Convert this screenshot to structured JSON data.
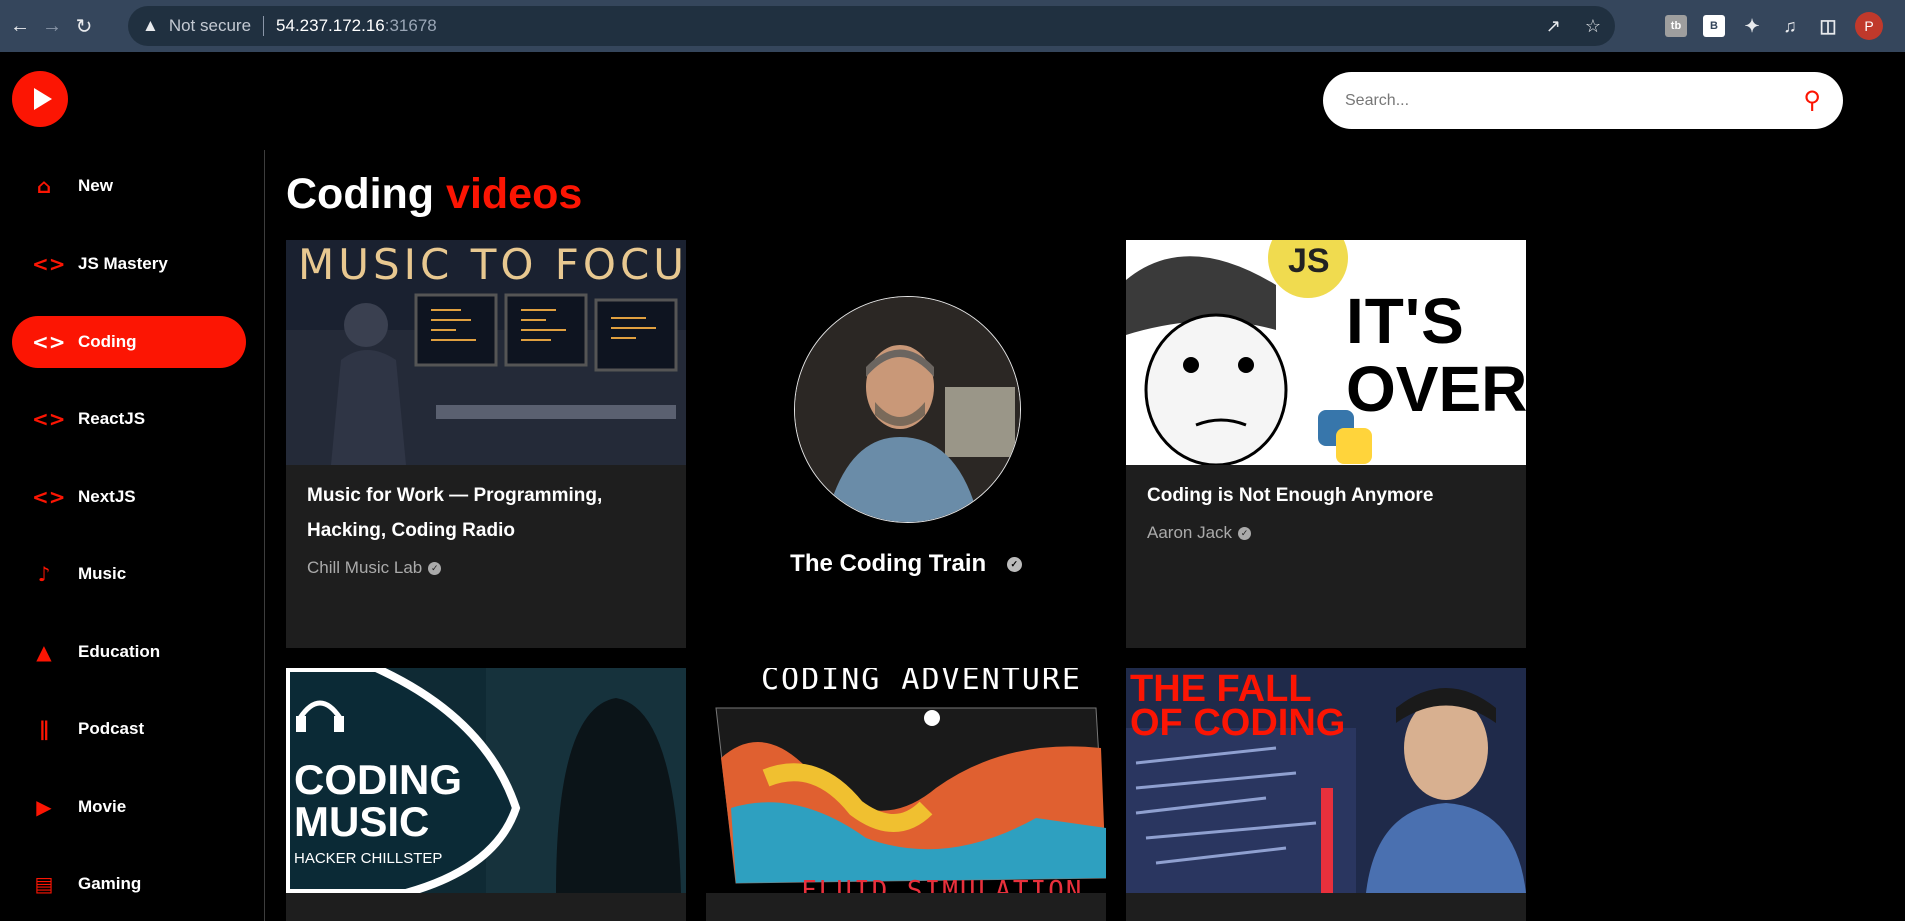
{
  "browser": {
    "warning_text": "Not secure",
    "url_host": "54.237.172.16",
    "url_port": ":31678",
    "ext_badges": [
      "tb",
      "B"
    ],
    "profile_initial": "P"
  },
  "search": {
    "placeholder": "Search..."
  },
  "title": {
    "main": "Coding",
    "accent": "videos"
  },
  "sidebar": {
    "items": [
      {
        "label": "New",
        "icon": "home-icon"
      },
      {
        "label": "JS Mastery",
        "icon": "code-icon"
      },
      {
        "label": "Coding",
        "icon": "code-icon",
        "active": true
      },
      {
        "label": "ReactJS",
        "icon": "code-icon"
      },
      {
        "label": "NextJS",
        "icon": "code-icon"
      },
      {
        "label": "Music",
        "icon": "music-note-icon"
      },
      {
        "label": "Education",
        "icon": "school-icon"
      },
      {
        "label": "Podcast",
        "icon": "podcast-icon"
      },
      {
        "label": "Movie",
        "icon": "live-tv-icon"
      },
      {
        "label": "Gaming",
        "icon": "gamepad-icon"
      }
    ]
  },
  "videos": [
    {
      "title": "Music for Work — Programming, Hacking, Coding Radio",
      "channel": "Chill Music Lab",
      "thumb_text": "MUSIC TO FOCU"
    },
    {
      "title": "Coding is Not Enough Anymore",
      "channel": "Aaron Jack",
      "thumb_text_1": "IT'S",
      "thumb_text_2": "OVER",
      "thumb_badge": "JS"
    },
    {
      "thumb_text_1": "CODING",
      "thumb_text_2": "MUSIC",
      "thumb_text_3": "HACKER CHILLSTEP"
    },
    {
      "thumb_text_1": "CODING ADVENTURE",
      "thumb_text_2": "FLUID SIMULATION"
    },
    {
      "thumb_text_1": "THE FALL",
      "thumb_text_2": "OF CODING"
    }
  ],
  "channel": {
    "name": "The Coding Train"
  },
  "colors": {
    "accent": "#fc1503",
    "card_bg": "#1e1e1e",
    "chrome_bg": "#35465c"
  }
}
